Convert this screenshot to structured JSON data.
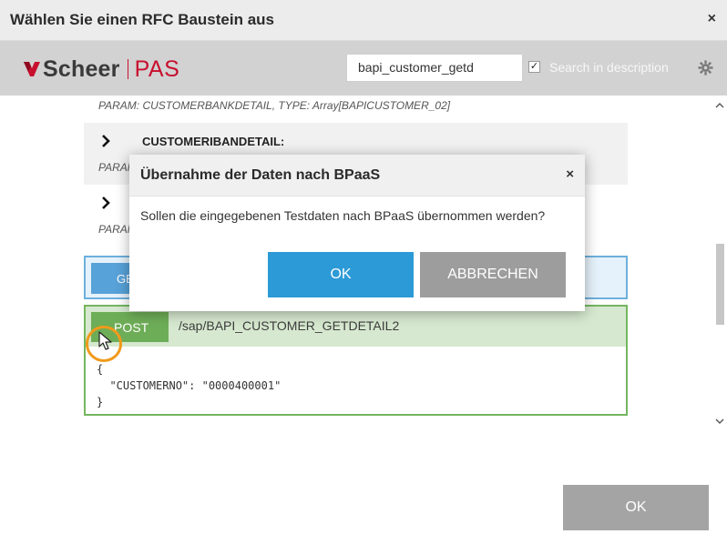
{
  "window": {
    "title": "Wählen Sie einen RFC Baustein aus",
    "close_glyph": "×"
  },
  "header": {
    "logo_scheer": "Scheer",
    "logo_pas": "PAS",
    "search_value": "bapi_customer_getd",
    "search_desc_checked": true,
    "search_desc_label": "Search in description",
    "settings_icon": "gear-icon",
    "brand_color": "#c8102e"
  },
  "list": {
    "param_bankdetail": "PARAM: CUSTOMERBANKDETAIL, TYPE: Array[BAPICUSTOMER_02]",
    "ibandetail_title": "CUSTOMERIBANDETAIL:",
    "ibandetail_param_prefix": "PARAM",
    "next_param_prefix": "PARAM",
    "get_badge_partial": "GE",
    "post_method": "POST",
    "post_path": "/sap/BAPI_CUSTOMER_GETDETAIL2",
    "code_open": "{",
    "code_line": "  \"CUSTOMERNO\": \"0000400001\"",
    "code_close": "}"
  },
  "modal": {
    "title": "Übernahme der Daten nach BPaaS",
    "close_glyph": "×",
    "message": "Sollen die eingegebenen Testdaten nach BPaaS übernommen werden?",
    "ok_label": "OK",
    "cancel_label": "ABBRECHEN",
    "ok_color": "#2c9ad6",
    "cancel_color": "#9d9d9d"
  },
  "footer": {
    "ok_label": "OK"
  }
}
